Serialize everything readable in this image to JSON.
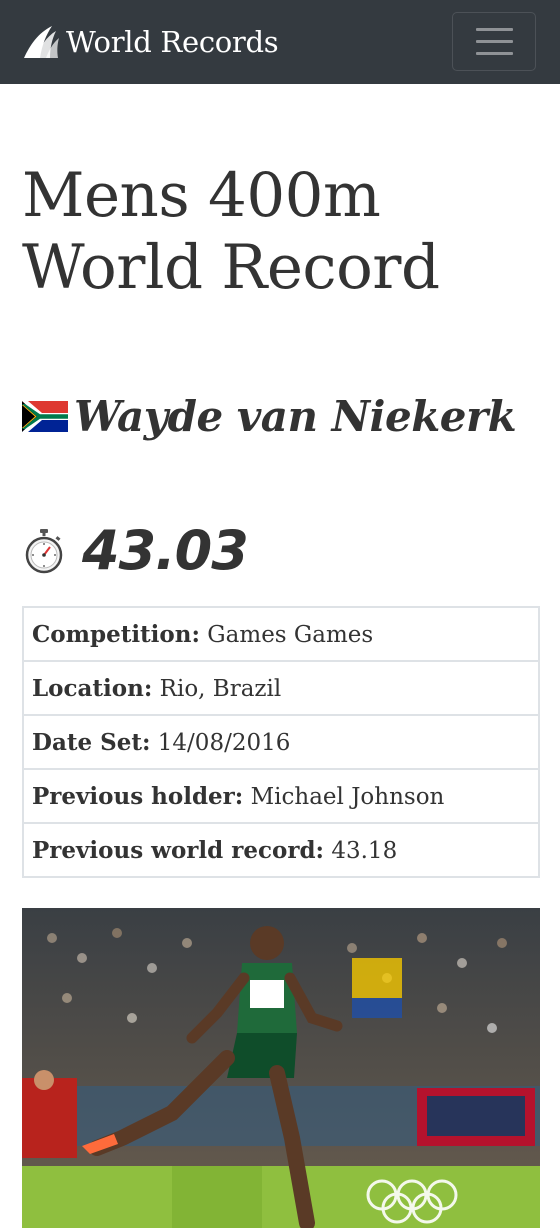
{
  "navbar": {
    "brand": "World Records",
    "logo_icon": "winged-logo-icon",
    "menu_icon": "hamburger-menu-icon"
  },
  "page": {
    "title_line1": "Mens 400m",
    "title_line2": "World Record"
  },
  "holder": {
    "flag_icon": "south-africa-flag-icon",
    "name": "Wayde van Niekerk"
  },
  "record": {
    "time_icon": "stopwatch-icon",
    "time": "43.03"
  },
  "details": [
    {
      "label": "Competition:",
      "value": " Games Games"
    },
    {
      "label": "Location:",
      "value": " Rio, Brazil"
    },
    {
      "label": "Date Set:",
      "value": " 14/08/2016"
    },
    {
      "label": "Previous holder:",
      "value": " Michael Johnson"
    },
    {
      "label": "Previous world record:",
      "value": " 43.18"
    }
  ],
  "colors": {
    "navbar": "#343a40",
    "text": "#333333",
    "border": "#dee2e6"
  }
}
